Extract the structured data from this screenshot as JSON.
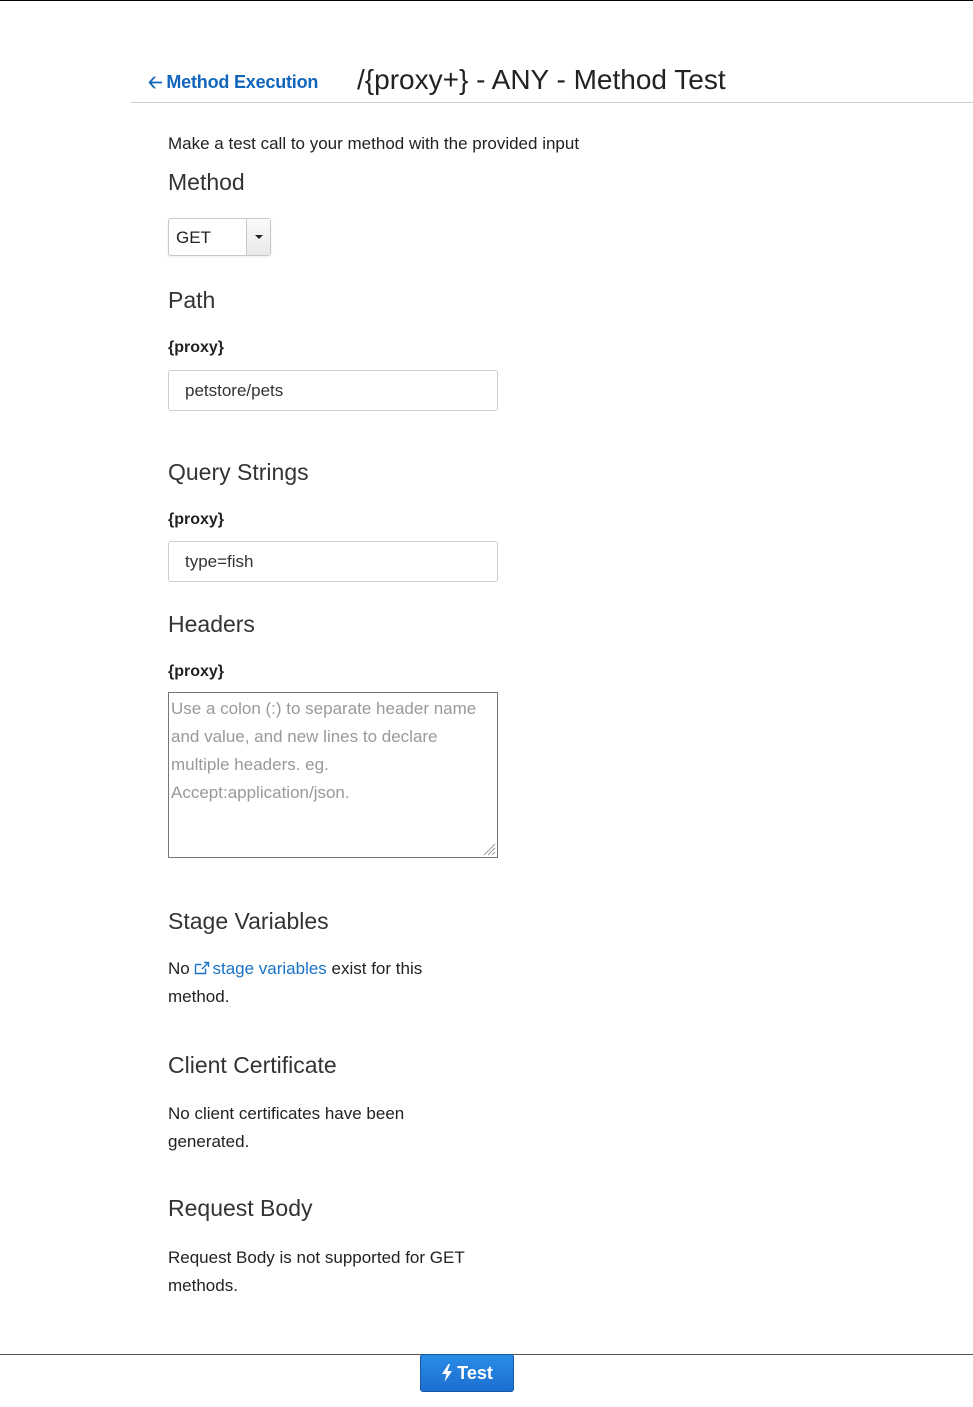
{
  "header": {
    "back_label": "Method Execution",
    "title": "/{proxy+} - ANY - Method Test"
  },
  "intro": "Make a test call to your method with the provided input",
  "method_section": {
    "heading": "Method",
    "selected": "GET"
  },
  "path_section": {
    "heading": "Path",
    "param_label": "{proxy}",
    "value": "petstore/pets"
  },
  "query_section": {
    "heading": "Query Strings",
    "param_label": "{proxy}",
    "value": "type=fish"
  },
  "headers_section": {
    "heading": "Headers",
    "param_label": "{proxy}",
    "placeholder": "Use a colon (:) to separate header name and value, and new lines to declare multiple headers. eg. Accept:application/json."
  },
  "stage_variables": {
    "heading": "Stage Variables",
    "text_before": "No ",
    "link": "stage variables",
    "text_after": " exist for this method."
  },
  "client_certificate": {
    "heading": "Client Certificate",
    "text": "No client certificates have been generated."
  },
  "request_body": {
    "heading": "Request Body",
    "text": "Request Body is not supported for GET methods."
  },
  "footer": {
    "test_label": "Test"
  },
  "colors": {
    "link": "#1a73c7",
    "primary_button": "#1b6fd0"
  },
  "icons": {
    "back": "arrow-left-icon",
    "external": "external-link-icon",
    "button": "bolt-icon"
  }
}
